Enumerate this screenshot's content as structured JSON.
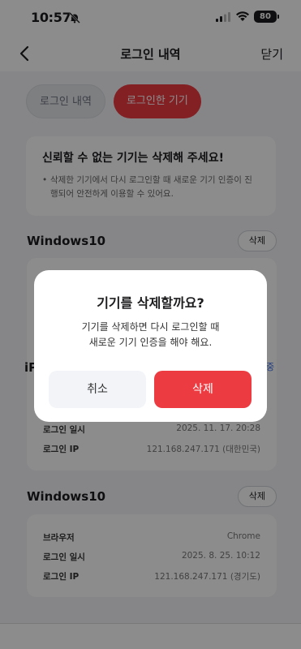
{
  "status_bar": {
    "time": "10:57",
    "battery": "80",
    "icons": [
      "bell-off-icon",
      "signal-icon",
      "wifi-icon",
      "battery-icon"
    ]
  },
  "nav": {
    "back_icon": "chevron-left-icon",
    "title": "로그인 내역",
    "close_label": "닫기"
  },
  "tabs": [
    {
      "label": "로그인 내역",
      "active": false
    },
    {
      "label": "로그인한 기기",
      "active": true
    }
  ],
  "notice": {
    "title": "신뢰할 수 없는 기기는 삭제해 주세요!",
    "body": "삭제한 기기에서 다시 로그인할 때 새로운 기기 인증이 진행되어 안전하게 이용할 수 있어요."
  },
  "devices": [
    {
      "name": "Windows10",
      "delete_label": "삭제",
      "rows": []
    },
    {
      "name_partial": "iP",
      "current_partial": "중",
      "rows": [
        {
          "label": "로그인 일시",
          "value": "2025. 11. 17. 20:28"
        },
        {
          "label": "로그인 IP",
          "value": "121.168.247.171 (대한민국)"
        }
      ]
    },
    {
      "name": "Windows10",
      "delete_label": "삭제",
      "rows": [
        {
          "label": "브라우저",
          "value": "Chrome"
        },
        {
          "label": "로그인 일시",
          "value": "2025. 8. 25. 10:12"
        },
        {
          "label": "로그인 IP",
          "value": "121.168.247.171 (경기도)"
        }
      ]
    }
  ],
  "dialog": {
    "title": "기기를 삭제할까요?",
    "message_line1": "기기를 삭제하면 다시 로그인할 때",
    "message_line2": "새로운 기기 인증을 해야 해요.",
    "cancel_label": "취소",
    "delete_label": "삭제"
  },
  "colors": {
    "accent": "#ee3b42",
    "background": "#f4f5f8",
    "overlay": "rgba(0,0,0,0.45)"
  }
}
